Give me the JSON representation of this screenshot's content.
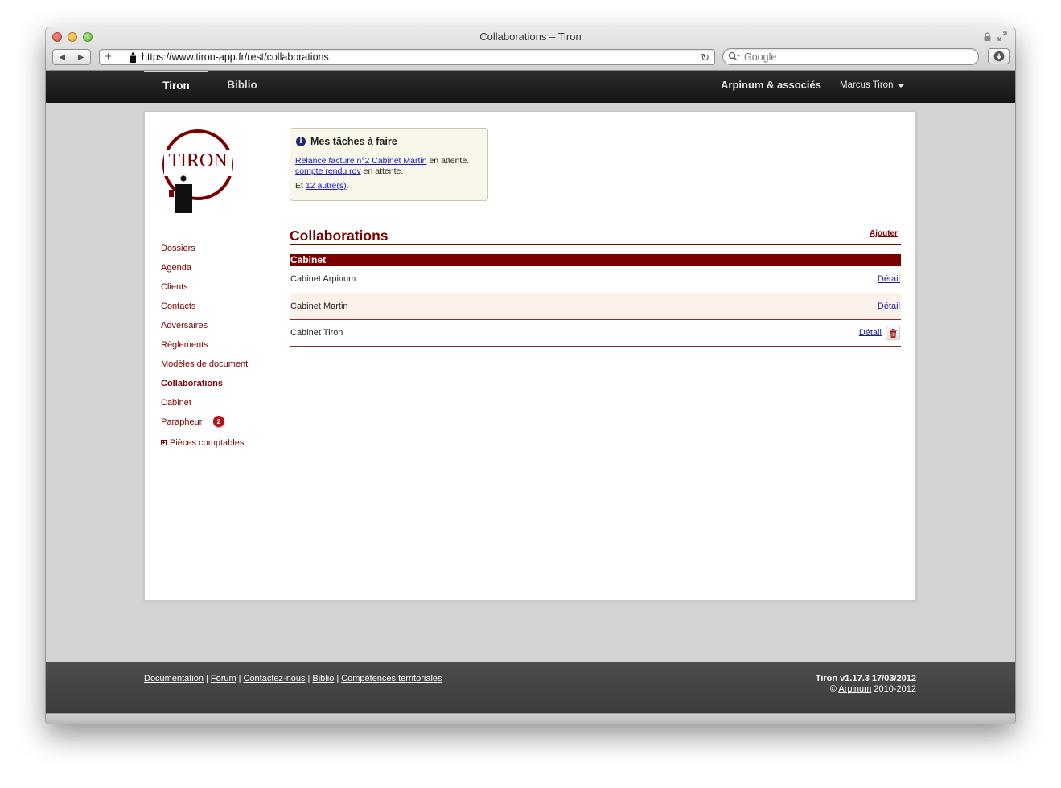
{
  "browser": {
    "window_title": "Collaborations – Tiron",
    "url": "https://www.tiron-app.fr/rest/collaborations",
    "search_placeholder": "Google"
  },
  "topnav": {
    "tabs": [
      {
        "label": "Tiron",
        "active": true
      },
      {
        "label": "Biblio",
        "active": false
      }
    ],
    "firm": "Arpinum & associés",
    "user": "Marcus Tiron"
  },
  "logo": {
    "text": "TIRON"
  },
  "sidebar": {
    "items": [
      {
        "label": "Dossiers"
      },
      {
        "label": "Agenda"
      },
      {
        "label": "Clients"
      },
      {
        "label": "Contacts"
      },
      {
        "label": "Adversaires"
      },
      {
        "label": "Règlements"
      },
      {
        "label": "Modèles de document"
      },
      {
        "label": "Collaborations",
        "active": true
      },
      {
        "label": "Cabinet"
      },
      {
        "label": "Parapheur",
        "badge": "2"
      },
      {
        "label": "Pièces comptables",
        "expandable": true
      }
    ]
  },
  "tasks": {
    "title": "Mes tâches à faire",
    "items": [
      {
        "link": "Relance facture n°2 Cabinet Martin",
        "suffix": "en attente."
      },
      {
        "link": "compte rendu rdv",
        "suffix": "en attente."
      }
    ],
    "more_prefix": "Et",
    "more_link": "12 autre(s)",
    "more_suffix": "."
  },
  "collaborations": {
    "title": "Collaborations",
    "add_label": "Ajouter",
    "group_header": "Cabinet",
    "detail_label": "Détail",
    "rows": [
      {
        "name": "Cabinet Arpinum"
      },
      {
        "name": "Cabinet Martin"
      },
      {
        "name": "Cabinet Tiron"
      }
    ]
  },
  "footer": {
    "links": [
      "Documentation",
      "Forum",
      "Contactez-nous",
      "Biblio",
      "Compétences territoriales"
    ],
    "version": "Tiron v1.17.3 17/03/2012",
    "copyright_prefix": "©",
    "copyright_link": "Arpinum",
    "copyright_years": "2010-2012"
  },
  "colors": {
    "accent": "#7a0000",
    "topnav_bg": "#1c1c1c",
    "footer_bg": "#454545",
    "badge": "#b3141e",
    "link_blue": "#1a1ad0"
  }
}
